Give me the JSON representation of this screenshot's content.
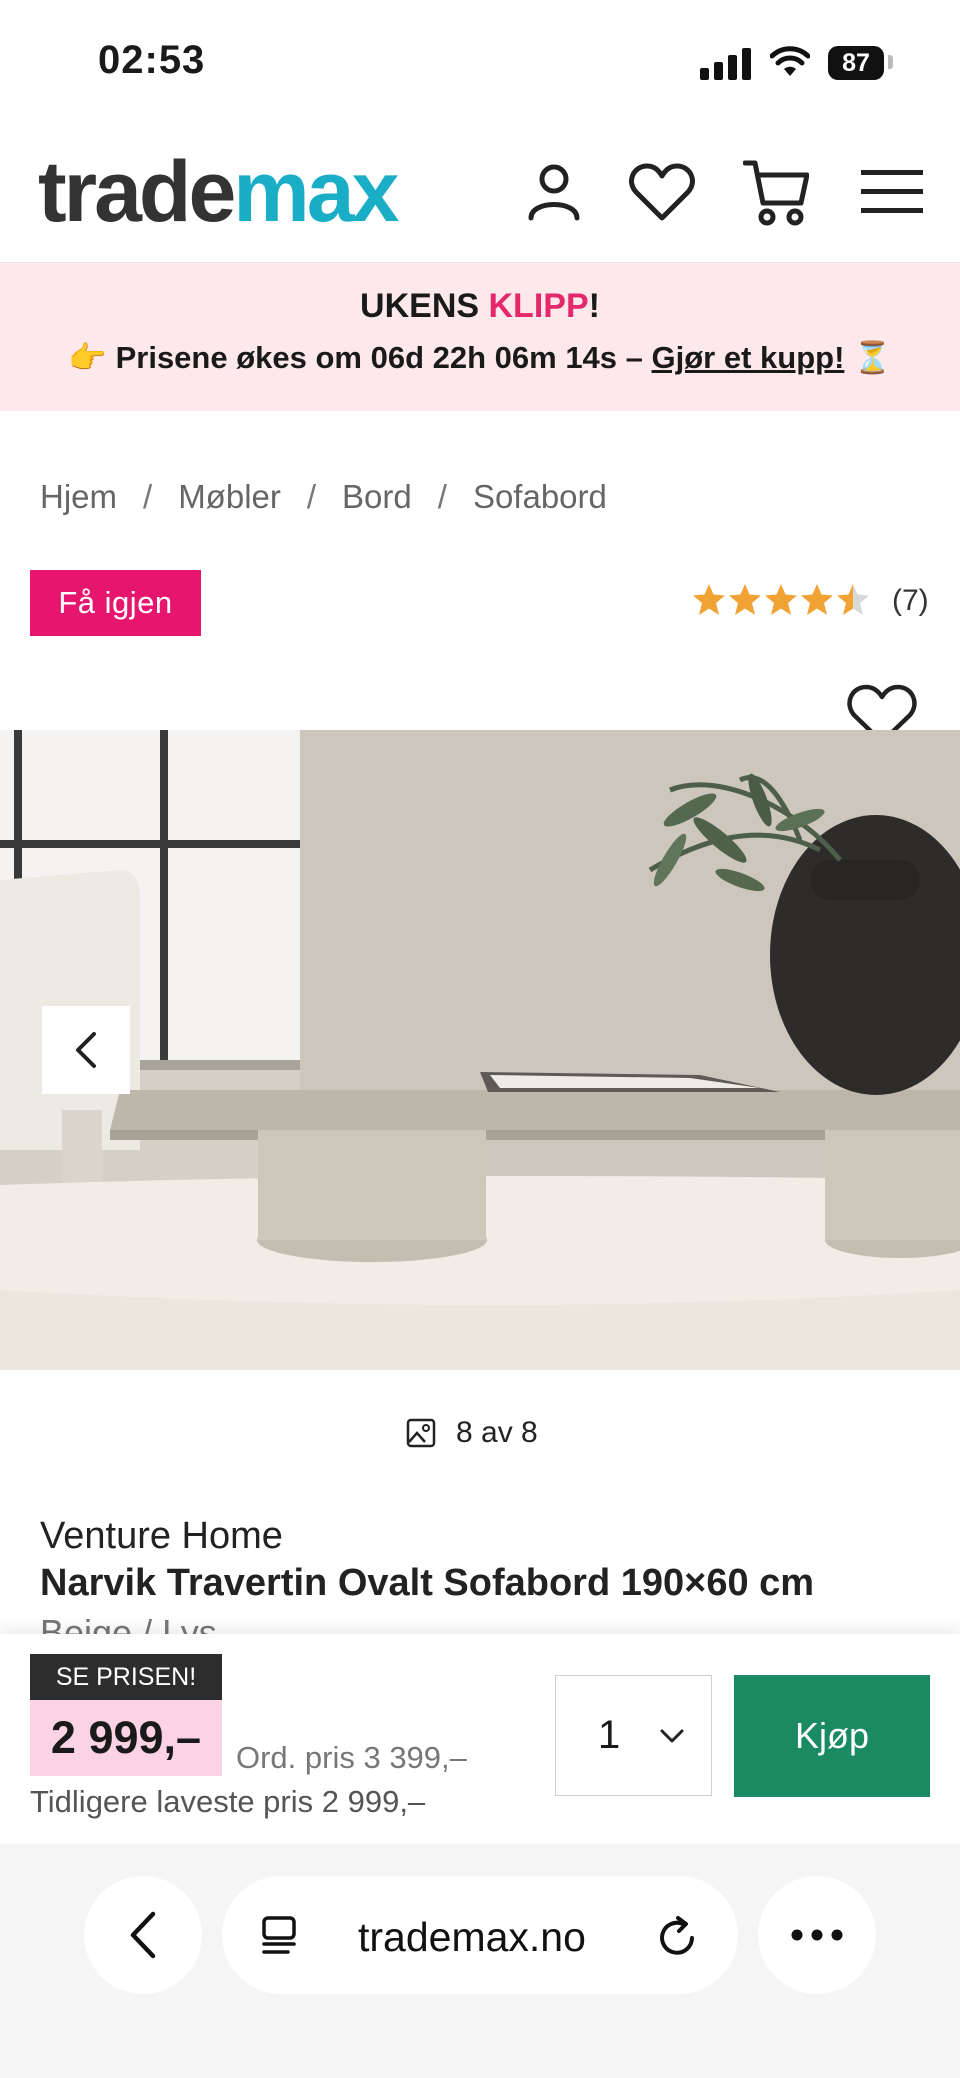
{
  "status_bar": {
    "time": "02:53",
    "battery": "87"
  },
  "header": {
    "logo_part1": "trade",
    "logo_part2": "max"
  },
  "promo": {
    "line1_a": "UKENS ",
    "line1_b": "KLIPP",
    "line1_c": "!",
    "line2_a": "👉 Prisene økes om 06d 22h 06m 14s – ",
    "line2_link": "Gjør et kupp!",
    "line2_b": " ⏳"
  },
  "breadcrumb": {
    "items": [
      "Hjem",
      "Møbler",
      "Bord",
      "Sofabord"
    ],
    "separator": "/"
  },
  "badge": "Få igjen",
  "rating": {
    "count": "(7)",
    "value": 4.5,
    "max": 5
  },
  "gallery": {
    "counter": "8 av 8"
  },
  "product": {
    "brand": "Venture Home",
    "name": "Narvik Travertin Ovalt Sofabord 190×60 cm",
    "color": "Beige / Lys"
  },
  "pricing": {
    "label": "SE PRISEN!",
    "price": "2 999,–",
    "ord_price": "Ord. pris 3 399,–",
    "lowest": "Tidligere laveste pris 2 999,–"
  },
  "purchase": {
    "quantity": "1",
    "buy_label": "Kjøp"
  },
  "browser": {
    "url": "trademax.no"
  },
  "colors": {
    "brand_teal": "#1aaec6",
    "badge_pink": "#e6166f",
    "buy_green": "#1a8a62",
    "star": "#f0a232"
  }
}
